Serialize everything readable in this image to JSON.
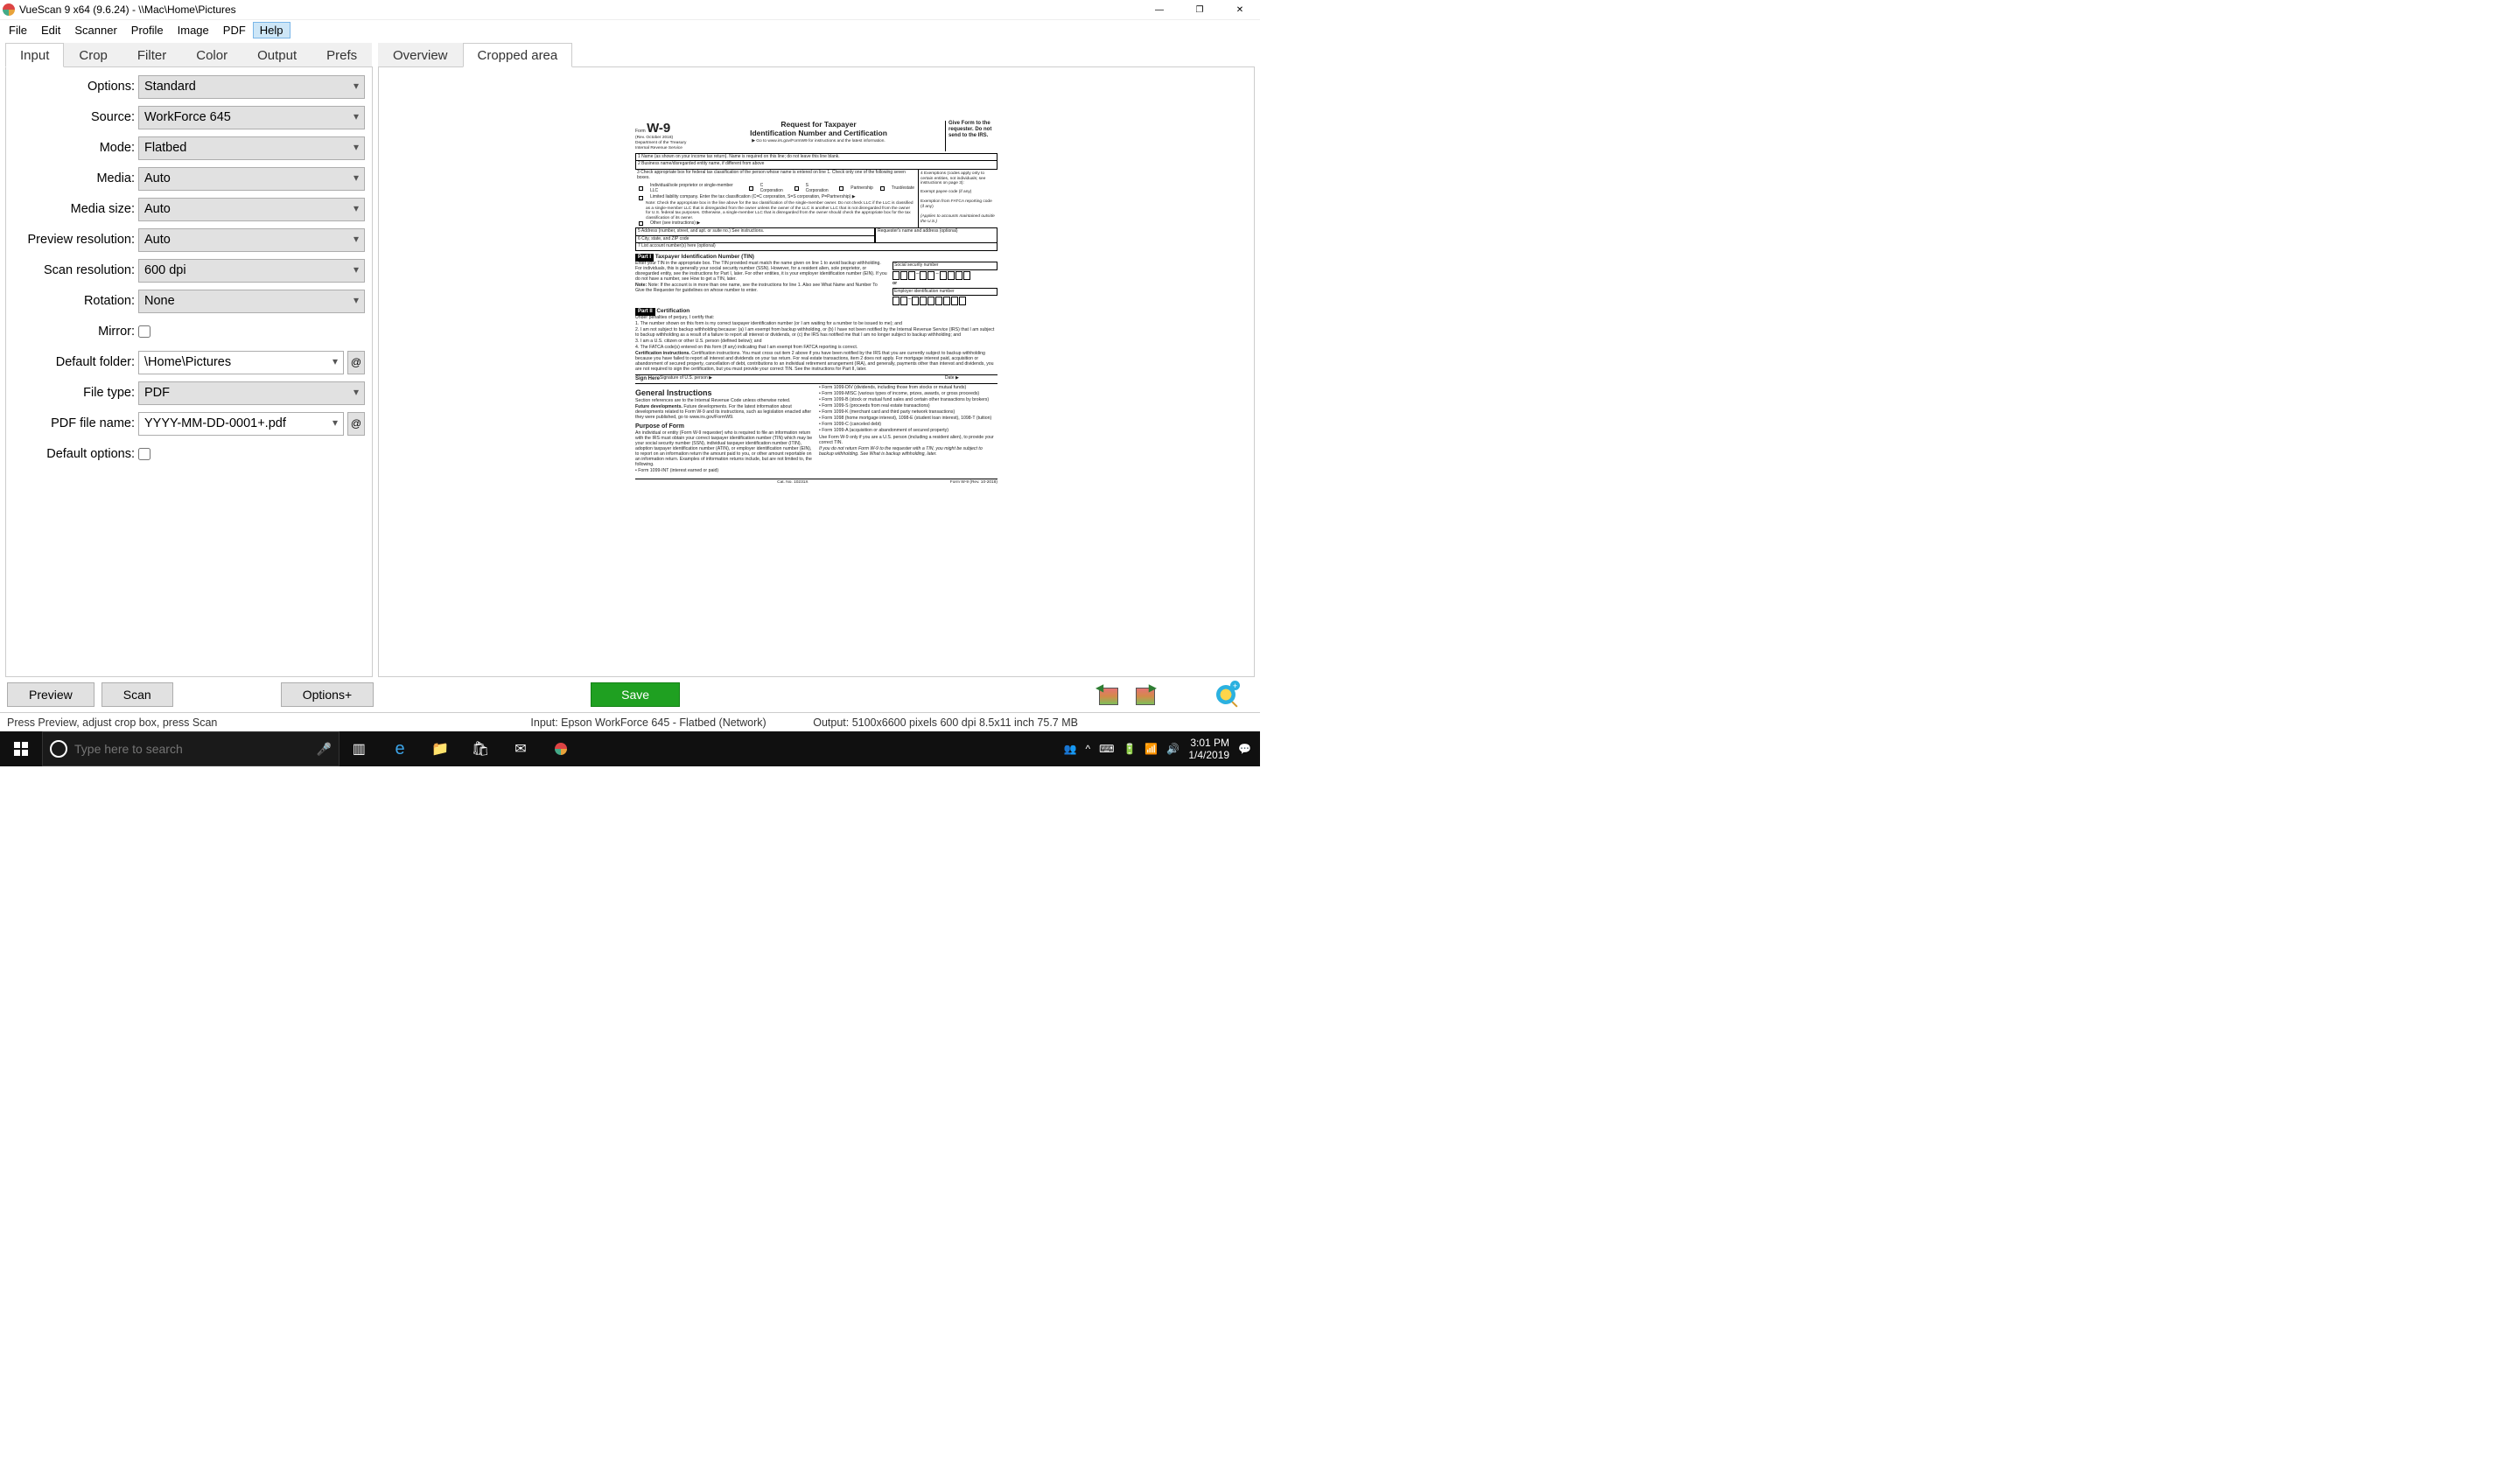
{
  "window": {
    "title": "VueScan 9 x64 (9.6.24) - \\\\Mac\\Home\\Pictures"
  },
  "menubar": [
    "File",
    "Edit",
    "Scanner",
    "Profile",
    "Image",
    "PDF",
    "Help"
  ],
  "menubar_active_index": 6,
  "left_tabs": [
    "Input",
    "Crop",
    "Filter",
    "Color",
    "Output",
    "Prefs"
  ],
  "right_tabs": [
    "Overview",
    "Cropped area"
  ],
  "form": {
    "options": {
      "label": "Options:",
      "value": "Standard"
    },
    "source": {
      "label": "Source:",
      "value": "WorkForce 645"
    },
    "mode": {
      "label": "Mode:",
      "value": "Flatbed"
    },
    "media": {
      "label": "Media:",
      "value": "Auto"
    },
    "media_size": {
      "label": "Media size:",
      "value": "Auto"
    },
    "preview_res": {
      "label": "Preview resolution:",
      "value": "Auto"
    },
    "scan_res": {
      "label": "Scan resolution:",
      "value": "600 dpi"
    },
    "rotation": {
      "label": "Rotation:",
      "value": "None"
    },
    "mirror": {
      "label": "Mirror:"
    },
    "default_folder": {
      "label": "Default folder:",
      "value": "\\Home\\Pictures"
    },
    "file_type": {
      "label": "File type:",
      "value": "PDF"
    },
    "pdf_file": {
      "label": "PDF file name:",
      "value": "YYYY-MM-DD-0001+.pdf"
    },
    "default_options": {
      "label": "Default options:"
    }
  },
  "buttons": {
    "preview": "Preview",
    "scan": "Scan",
    "options_more": "Options+",
    "save": "Save"
  },
  "status": {
    "left": "Press Preview, adjust crop box, press Scan",
    "mid": "Input: Epson WorkForce 645 - Flatbed (Network)",
    "right": "Output: 5100x6600 pixels 600 dpi 8.5x11 inch 75.7 MB"
  },
  "taskbar": {
    "search_placeholder": "Type here to search",
    "time": "3:01 PM",
    "date": "1/4/2019"
  },
  "doc": {
    "form_no": "W-9",
    "form_sub": "(Rev. October 2018)\nDepartment of the Treasury\nInternal Revenue Service",
    "title1": "Request for Taxpayer",
    "title2": "Identification Number and Certification",
    "title3": "▶ Go to www.irs.gov/FormW9 for instructions and the latest information.",
    "give": "Give Form to the requester. Do not send to the IRS.",
    "line1": "1  Name (as shown on your income tax return). Name is required on this line; do not leave this line blank.",
    "line2": "2  Business name/disregarded entity name, if different from above",
    "line3a": "3  Check appropriate box for federal tax classification of the person whose name is entered on line 1. Check only one of the following seven boxes.",
    "line3b": "Individual/sole proprietor or single-member LLC",
    "line3c": "C Corporation",
    "line3d": "S Corporation",
    "line3e": "Partnership",
    "line3f": "Trust/estate",
    "line3g": "Limited liability company. Enter the tax classification (C=C corporation, S=S corporation, P=Partnership) ▶",
    "line3h": "Note: Check the appropriate box in the line above for the tax classification of the single-member owner. Do not check LLC if the LLC is classified as a single-member LLC that is disregarded from the owner unless the owner of the LLC is another LLC that is not disregarded from the owner for U.S. federal tax purposes. Otherwise, a single-member LLC that is disregarded from the owner should check the appropriate box for the tax classification of its owner.",
    "line3i": "Other (see instructions) ▶",
    "line4a": "4  Exemptions (codes apply only to certain entities, not individuals; see instructions on page 3):",
    "line4b": "Exempt payee code (if any)",
    "line4c": "Exemption from FATCA reporting code (if any)",
    "line4d": "(Applies to accounts maintained outside the U.S.)",
    "line5": "5  Address (number, street, and apt. or suite no.) See instructions.",
    "line5r": "Requester's name and address (optional)",
    "line6": "6  City, state, and ZIP code",
    "line7": "7  List account number(s) here (optional)",
    "part1": "Part I",
    "part1_title": "Taxpayer Identification Number (TIN)",
    "part1_text": "Enter your TIN in the appropriate box. The TIN provided must match the name given on line 1 to avoid backup withholding. For individuals, this is generally your social security number (SSN). However, for a resident alien, sole proprietor, or disregarded entity, see the instructions for Part I, later. For other entities, it is your employer identification number (EIN). If you do not have a number, see How to get a TIN, later.",
    "part1_note": "Note: If the account is in more than one name, see the instructions for line 1. Also see What Name and Number To Give the Requester for guidelines on whose number to enter.",
    "ssn": "Social security number",
    "or": "or",
    "ein": "Employer identification number",
    "part2": "Part II",
    "part2_title": "Certification",
    "cert_intro": "Under penalties of perjury, I certify that:",
    "cert1": "1. The number shown on this form is my correct taxpayer identification number (or I am waiting for a number to be issued to me); and",
    "cert2": "2. I am not subject to backup withholding because: (a) I am exempt from backup withholding, or (b) I have not been notified by the Internal Revenue Service (IRS) that I am subject to backup withholding as a result of a failure to report all interest or dividends, or (c) the IRS has notified me that I am no longer subject to backup withholding; and",
    "cert3": "3. I am a U.S. citizen or other U.S. person (defined below); and",
    "cert4": "4. The FATCA code(s) entered on this form (if any) indicating that I am exempt from FATCA reporting is correct.",
    "cert_instr": "Certification instructions. You must cross out item 2 above if you have been notified by the IRS that you are currently subject to backup withholding because you have failed to report all interest and dividends on your tax return. For real estate transactions, item 2 does not apply. For mortgage interest paid, acquisition or abandonment of secured property, cancellation of debt, contributions to an individual retirement arrangement (IRA), and generally, payments other than interest and dividends, you are not required to sign the certification, but you must provide your correct TIN. See the instructions for Part II, later.",
    "sign": "Sign Here",
    "sign_of": "Signature of U.S. person ▶",
    "date": "Date ▶",
    "gi": "General Instructions",
    "gi_text": "Section references are to the Internal Revenue Code unless otherwise noted.",
    "fd": "Future developments. For the latest information about developments related to Form W-9 and its instructions, such as legislation enacted after they were published, go to www.irs.gov/FormW9.",
    "purpose": "Purpose of Form",
    "purpose_text": "An individual or entity (Form W-9 requester) who is required to file an information return with the IRS must obtain your correct taxpayer identification number (TIN) which may be your social security number (SSN), individual taxpayer identification number (ITIN), adoption taxpayer identification number (ATIN), or employer identification number (EIN), to report on an information return the amount paid to you, or other amount reportable on an information return. Examples of information returns include, but are not limited to, the following.",
    "b1": "• Form 1099-INT (interest earned or paid)",
    "r1": "• Form 1099-DIV (dividends, including those from stocks or mutual funds)",
    "r2": "• Form 1099-MISC (various types of income, prizes, awards, or gross proceeds)",
    "r3": "• Form 1099-B (stock or mutual fund sales and certain other transactions by brokers)",
    "r4": "• Form 1099-S (proceeds from real estate transactions)",
    "r5": "• Form 1099-K (merchant card and third party network transactions)",
    "r6": "• Form 1098 (home mortgage interest), 1098-E (student loan interest), 1098-T (tuition)",
    "r7": "• Form 1099-C (canceled debt)",
    "r8": "• Form 1099-A (acquisition or abandonment of secured property)",
    "r9": "Use Form W-9 only if you are a U.S. person (including a resident alien), to provide your correct TIN.",
    "r10": "If you do not return Form W-9 to the requester with a TIN, you might be subject to backup withholding. See What is backup withholding, later.",
    "cat": "Cat. No. 10231X",
    "foot": "Form W-9 (Rev. 10-2018)"
  }
}
